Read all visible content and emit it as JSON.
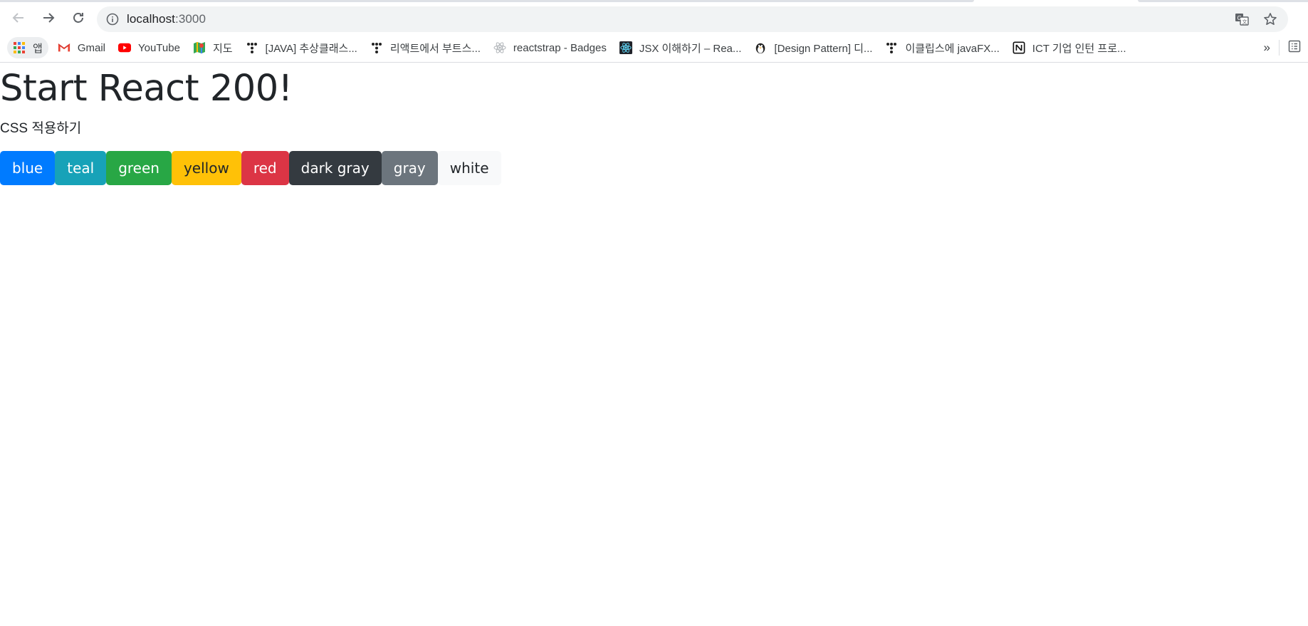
{
  "browser": {
    "url_host": "localhost",
    "url_port": ":3000",
    "bookmarks": [
      {
        "label": "앱",
        "icon": "apps-grid-icon"
      },
      {
        "label": "Gmail",
        "icon": "gmail-icon"
      },
      {
        "label": "YouTube",
        "icon": "youtube-icon"
      },
      {
        "label": "지도",
        "icon": "maps-icon"
      },
      {
        "label": "[JAVA] 추상클래스...",
        "icon": "tistory-icon"
      },
      {
        "label": "리액트에서 부트스...",
        "icon": "tistory-icon"
      },
      {
        "label": "reactstrap - Badges",
        "icon": "react-icon"
      },
      {
        "label": "JSX 이해하기 – Rea...",
        "icon": "react-dark-icon"
      },
      {
        "label": "[Design Pattern] 디...",
        "icon": "penguin-icon"
      },
      {
        "label": "이클립스에 javaFX...",
        "icon": "tistory-icon"
      },
      {
        "label": "ICT 기업 인턴 프로...",
        "icon": "notion-icon"
      }
    ],
    "more_label": "»"
  },
  "page": {
    "title": "Start React 200!",
    "subtitle": "CSS 적용하기",
    "buttons": [
      {
        "label": "blue",
        "bg": "#007bff",
        "fg": "#ffffff"
      },
      {
        "label": "teal",
        "bg": "#17a2b8",
        "fg": "#ffffff"
      },
      {
        "label": "green",
        "bg": "#28a745",
        "fg": "#ffffff"
      },
      {
        "label": "yellow",
        "bg": "#ffc107",
        "fg": "#212529"
      },
      {
        "label": "red",
        "bg": "#dc3545",
        "fg": "#ffffff"
      },
      {
        "label": "dark gray",
        "bg": "#343a40",
        "fg": "#ffffff"
      },
      {
        "label": "gray",
        "bg": "#6c757d",
        "fg": "#ffffff"
      },
      {
        "label": "white",
        "bg": "#f8f9fa",
        "fg": "#212529"
      }
    ]
  }
}
